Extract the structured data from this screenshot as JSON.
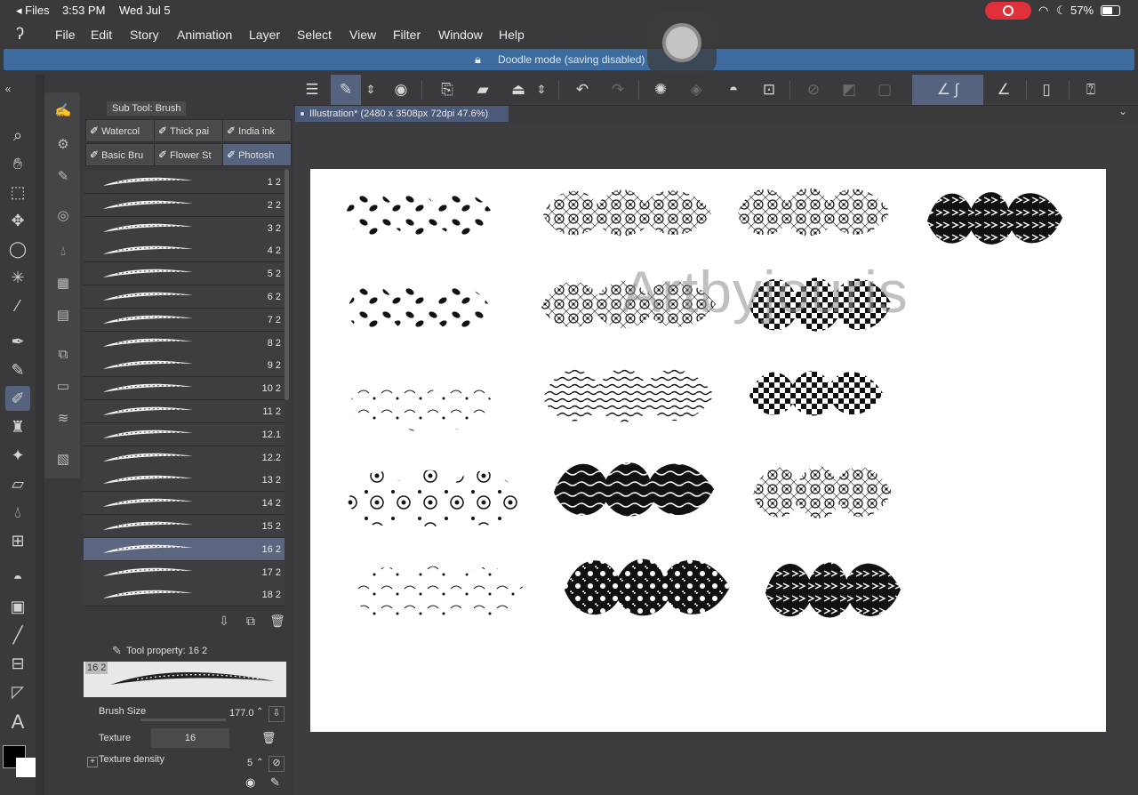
{
  "status": {
    "app": "◂ Files",
    "time": "3:53 PM",
    "date": "Wed Jul 5",
    "battery": "57%"
  },
  "menu": [
    "File",
    "Edit",
    "Story",
    "Animation",
    "Layer",
    "Select",
    "View",
    "Filter",
    "Window",
    "Help"
  ],
  "doodle": {
    "text": "Doodle mode (saving disabled)"
  },
  "document": {
    "tab": "Illustration* (2480 x 3508px 72dpi 47.6%)",
    "watermark": "Artbyjouris"
  },
  "subtool": {
    "title": "Sub Tool: Brush",
    "tabs": [
      {
        "label": "Watercol"
      },
      {
        "label": "Thick pai"
      },
      {
        "label": "India ink"
      },
      {
        "label": "Basic Bru"
      },
      {
        "label": "Flower St"
      },
      {
        "label": "Photosh"
      }
    ],
    "brushes": [
      "1 2",
      "2 2",
      "3 2",
      "4 2",
      "5 2",
      "6 2",
      "7 2",
      "8 2",
      "9 2",
      "10 2",
      "11 2",
      "12.1",
      "12.2",
      "13 2",
      "14 2",
      "15 2",
      "16 2",
      "17 2",
      "18 2"
    ],
    "selected_index": 16
  },
  "property": {
    "title": "Tool property: 16 2",
    "preview_label": "16 2",
    "brush_size_label": "Brush Size",
    "brush_size": "177.0",
    "texture_label": "Texture",
    "texture_value": "16",
    "density_label": "Texture density",
    "density_value": "5"
  },
  "colors": {
    "accent": "#55637e",
    "doodle": "#3f6c9f",
    "record": "#e0303a"
  }
}
